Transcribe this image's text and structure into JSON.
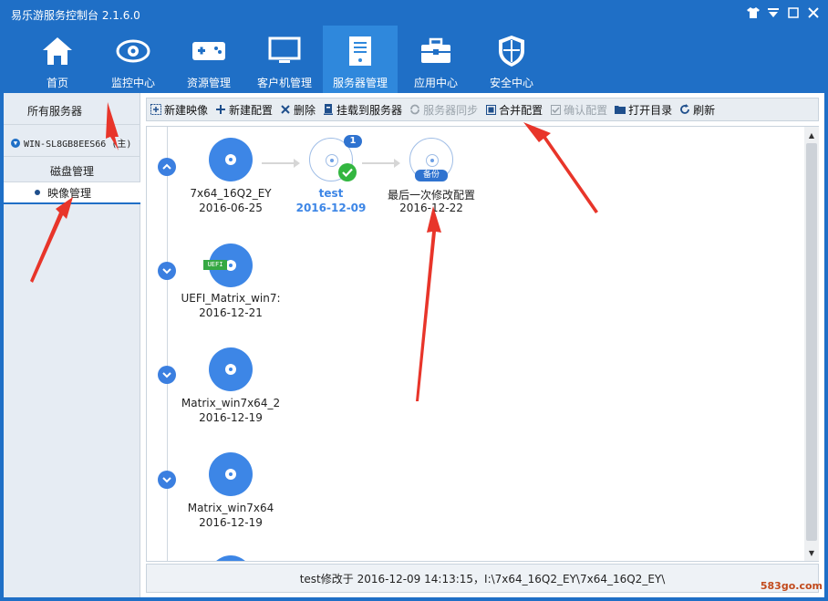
{
  "window": {
    "title": "易乐游服务控制台 2.1.6.0",
    "controls": [
      "shirt-icon",
      "menu-down-icon",
      "maximize-icon",
      "close-icon"
    ]
  },
  "nav": [
    {
      "label": "首页",
      "icon": "home-icon",
      "active": false
    },
    {
      "label": "监控中心",
      "icon": "eye-icon",
      "active": false
    },
    {
      "label": "资源管理",
      "icon": "gamepad-icon",
      "active": false
    },
    {
      "label": "客户机管理",
      "icon": "monitor-icon",
      "active": false
    },
    {
      "label": "服务器管理",
      "icon": "server-icon",
      "active": true
    },
    {
      "label": "应用中心",
      "icon": "toolbox-icon",
      "active": false
    },
    {
      "label": "安全中心",
      "icon": "shield-icon",
      "active": false
    }
  ],
  "sidebar": {
    "all_servers": "所有服务器",
    "server_name": "WIN-SL8GB8EES66 (主)",
    "disk_mgmt": "磁盘管理",
    "image_mgmt": "映像管理"
  },
  "toolbar": {
    "new_image": "新建映像",
    "new_config": "新建配置",
    "delete": "删除",
    "mount": "挂载到服务器",
    "sync": "服务器同步",
    "merge": "合并配置",
    "confirm": "确认配置",
    "open_dir": "打开目录",
    "refresh": "刷新"
  },
  "images": [
    {
      "name": "7x64_16Q2_EY",
      "date": "2016-06-25"
    },
    {
      "name": "test",
      "date": "2016-12-09",
      "badge": "1"
    },
    {
      "name": "最后一次修改配置",
      "date": "2016-12-22",
      "badge": "备份"
    },
    {
      "name": "UEFI_Matrix_win7:",
      "date": "2016-12-21",
      "badge": "UEFI"
    },
    {
      "name": "Matrix_win7x64_2",
      "date": "2016-12-19"
    },
    {
      "name": "Matrix_win7x64",
      "date": "2016-12-19"
    }
  ],
  "status": "test修改于 2016-12-09 14:13:15，I:\\7x64_16Q2_EY\\7x64_16Q2_EY\\",
  "watermark": "583go.com",
  "colors": {
    "accent": "#1f6fc6",
    "disc": "#3d86e6",
    "ok": "#33b640",
    "annotation": "#e8352a"
  }
}
